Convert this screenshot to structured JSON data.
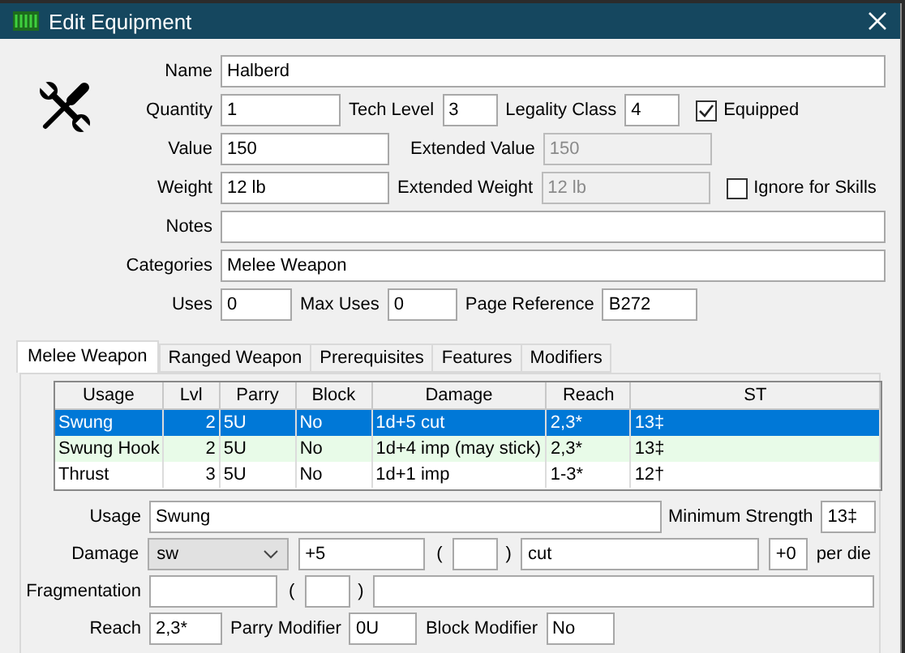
{
  "window": {
    "title": "Edit Equipment"
  },
  "name": {
    "label": "Name",
    "value": "Halberd"
  },
  "quantity": {
    "label": "Quantity",
    "value": "1"
  },
  "tech_level": {
    "label": "Tech Level",
    "value": "3"
  },
  "legality_class": {
    "label": "Legality Class",
    "value": "4"
  },
  "equipped": {
    "label": "Equipped",
    "checked": true
  },
  "value": {
    "label": "Value",
    "value": "150"
  },
  "extended_value": {
    "label": "Extended Value",
    "value": "150",
    "disabled": true
  },
  "weight": {
    "label": "Weight",
    "value": "12 lb"
  },
  "extended_weight": {
    "label": "Extended Weight",
    "value": "12 lb",
    "disabled": true
  },
  "ignore_for_skills": {
    "label": "Ignore for Skills",
    "checked": false
  },
  "notes": {
    "label": "Notes"
  },
  "categories": {
    "label": "Categories",
    "value": "Melee Weapon"
  },
  "uses": {
    "label": "Uses",
    "value": "0"
  },
  "max_uses": {
    "label": "Max Uses",
    "value": "0"
  },
  "page_reference": {
    "label": "Page Reference",
    "value": "B272"
  },
  "tabs": [
    {
      "label": "Melee Weapon",
      "selected": true
    },
    {
      "label": "Ranged Weapon",
      "selected": false
    },
    {
      "label": "Prerequisites",
      "selected": false
    },
    {
      "label": "Features",
      "selected": false
    },
    {
      "label": "Modifiers",
      "selected": false
    }
  ],
  "table": {
    "columns": [
      "Usage",
      "Lvl",
      "Parry",
      "Block",
      "Damage",
      "Reach",
      "ST"
    ],
    "rows": [
      {
        "cells": [
          "Swung",
          "2",
          "5U",
          "No",
          "1d+5 cut",
          "2,3*",
          "13‡"
        ],
        "selected": true
      },
      {
        "cells": [
          "Swung Hook",
          "2",
          "5U",
          "No",
          "1d+4 imp (may stick)",
          "2,3*",
          "13‡"
        ],
        "selected": false
      },
      {
        "cells": [
          "Thrust",
          "3",
          "5U",
          "No",
          "1d+1 imp",
          "1-3*",
          "12†"
        ],
        "selected": false
      }
    ]
  },
  "detail": {
    "usage": {
      "label": "Usage",
      "value": "Swung"
    },
    "minimum_strength": {
      "label": "Minimum Strength",
      "value": "13‡"
    },
    "damage": {
      "label": "Damage",
      "type": "sw",
      "base": "+5",
      "open": "(",
      "close": ")",
      "damage_type": "cut",
      "per_die": "+0",
      "per_die_label": "per die"
    },
    "fragmentation": {
      "label": "Fragmentation",
      "open": "(",
      "close": ")"
    },
    "reach": {
      "label": "Reach",
      "value": "2,3*"
    },
    "parry_modifier": {
      "label": "Parry Modifier",
      "value": "0U"
    },
    "block_modifier": {
      "label": "Block Modifier",
      "value": "No"
    }
  }
}
